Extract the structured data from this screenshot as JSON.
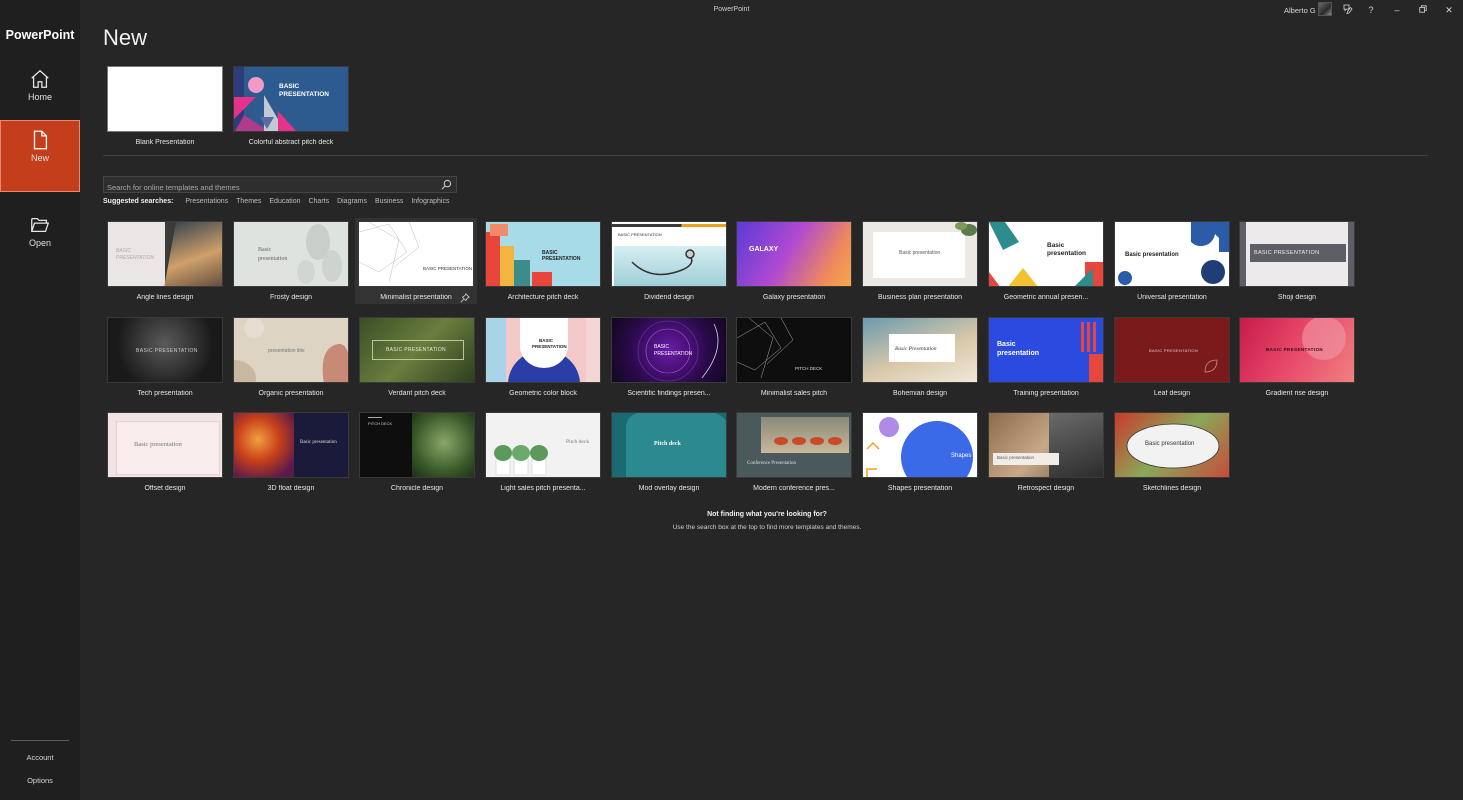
{
  "app": {
    "brand": "PowerPoint",
    "window_title": "PowerPoint",
    "user_name": "Alberto G"
  },
  "sidebar": {
    "home": "Home",
    "new": "New",
    "open": "Open",
    "account": "Account",
    "options": "Options"
  },
  "main": {
    "title": "New",
    "featured": [
      {
        "label": "Blank Presentation"
      },
      {
        "label": "Colorful abstract pitch deck",
        "thumb_text": "BASIC PRESENTATION"
      }
    ],
    "search": {
      "placeholder": "Search for online templates and themes"
    },
    "suggested": {
      "label": "Suggested searches:",
      "items": [
        "Presentations",
        "Themes",
        "Education",
        "Charts",
        "Diagrams",
        "Business",
        "Infographics"
      ]
    },
    "templates": [
      {
        "label": "Angle lines design",
        "thumb_text": "BASIC PRESENTATION"
      },
      {
        "label": "Frosty design",
        "thumb_text": "Basic presentation"
      },
      {
        "label": "Minimalist presentation",
        "thumb_text": "BASIC PRESENTATION"
      },
      {
        "label": "Architecture pitch deck",
        "thumb_text": "BASIC PRESENTATION"
      },
      {
        "label": "Dividend design",
        "thumb_text": "BASIC PRESENTATION"
      },
      {
        "label": "Galaxy presentation",
        "thumb_text": "GALAXY"
      },
      {
        "label": "Business plan presentation",
        "thumb_text": "Basic presentation"
      },
      {
        "label": "Geometric annual presen...",
        "thumb_text": "Basic presentation"
      },
      {
        "label": "Universal presentation",
        "thumb_text": "Basic presentation"
      },
      {
        "label": "Shoji design",
        "thumb_text": "BASIC PRESENTATION"
      },
      {
        "label": "Tech presentation",
        "thumb_text": "BASIC PRESENTATION"
      },
      {
        "label": "Organic presentation",
        "thumb_text": "presentation title"
      },
      {
        "label": "Verdant pitch deck",
        "thumb_text": "BASIC PRESENTATION"
      },
      {
        "label": "Geometric color block",
        "thumb_text": "BASIC PRESENTATION"
      },
      {
        "label": "Scientific findings presen...",
        "thumb_text": "BASIC PRESENTATION"
      },
      {
        "label": "Minimalist sales pitch",
        "thumb_text": "PITCH DECK"
      },
      {
        "label": "Bohemian design",
        "thumb_text": "Basic Presentation"
      },
      {
        "label": "Training presentation",
        "thumb_text": "Basic presentation"
      },
      {
        "label": "Leaf design",
        "thumb_text": "BASIC PRESENTATION"
      },
      {
        "label": "Gradient rise design",
        "thumb_text": "BASIC PRESENTATION"
      },
      {
        "label": "Offset design",
        "thumb_text": "Basic presentation"
      },
      {
        "label": "3D float design",
        "thumb_text": "Basic presentation"
      },
      {
        "label": "Chronicle design",
        "thumb_text": "PITCH DECK"
      },
      {
        "label": "Light sales pitch presenta...",
        "thumb_text": "Pitch deck"
      },
      {
        "label": "Mod overlay design",
        "thumb_text": "Pitch deck"
      },
      {
        "label": "Modern conference pres...",
        "thumb_text": "Conference Presentation"
      },
      {
        "label": "Shapes presentation",
        "thumb_text": "Shapes"
      },
      {
        "label": "Retrospect design",
        "thumb_text": "Basic presentation"
      },
      {
        "label": "Sketchlines design",
        "thumb_text": "Basic presentation"
      }
    ],
    "not_found_title": "Not finding what you're looking for?",
    "not_found_sub": "Use the search box at the top to find more templates and themes."
  },
  "colors": {
    "accent": "#c43e1c",
    "background": "#262626",
    "sidebar": "#1f1f1f"
  }
}
